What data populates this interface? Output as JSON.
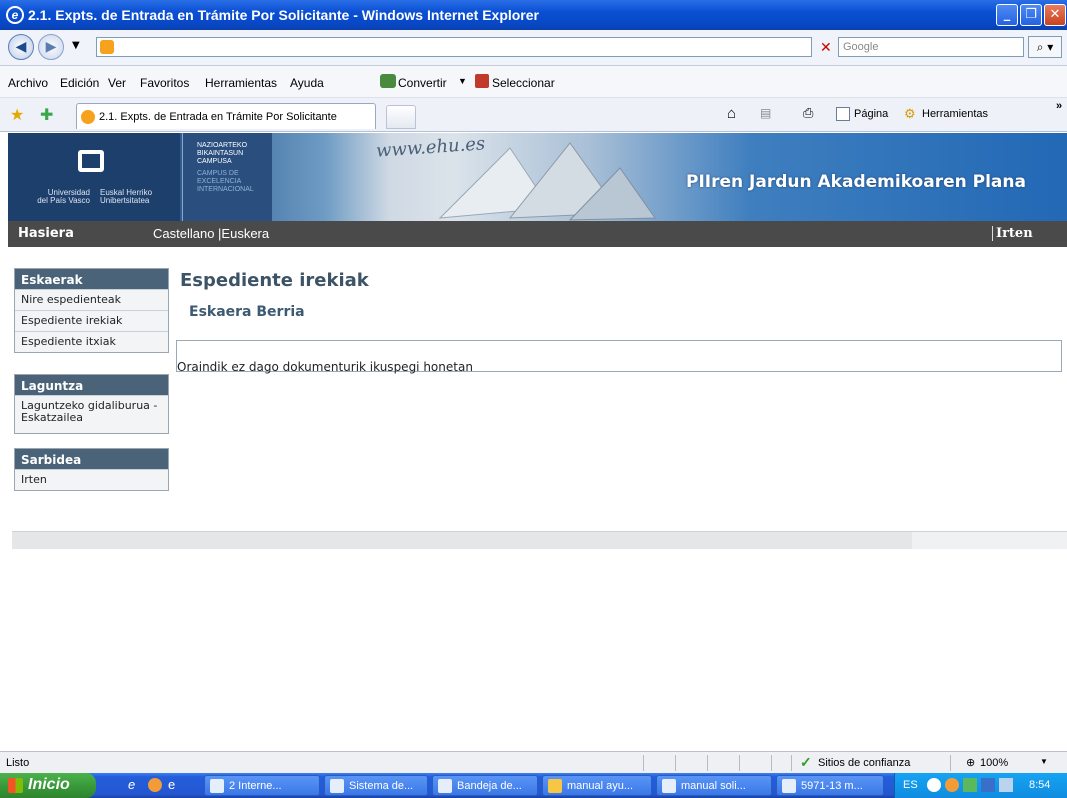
{
  "window": {
    "title": "2.1. Expts. de Entrada en Trámite Por Solicitante - Windows Internet Explorer",
    "minimize": "_",
    "maximize": "❐",
    "close": "✕"
  },
  "browser": {
    "address_value": "",
    "search_placeholder": "Google",
    "menu": [
      "Archivo",
      "Edición",
      "Ver",
      "Favoritos",
      "Herramientas",
      "Ayuda"
    ],
    "convert_label": "Convertir",
    "select_label": "Seleccionar",
    "tab_title": "2.1. Expts. de Entrada en Trámite Por Solicitante",
    "page_label": "Página",
    "tools_label": "Herramientas"
  },
  "banner": {
    "uni_left": [
      "Universidad",
      "del País Vasco"
    ],
    "uni_right": [
      "Euskal Herriko",
      "Unibertsitatea"
    ],
    "campus_lines_top": [
      "NAZIOARTEKO",
      "BIKAINTASUN",
      "CAMPUSA"
    ],
    "campus_lines_bottom": [
      "CAMPUS DE",
      "EXCELENCIA",
      "INTERNACIONAL"
    ],
    "www": "www.ehu.es",
    "title": "PIIren Jardun Akademikoaren Plana"
  },
  "nav": {
    "home": "Hasiera",
    "languages": "Castellano |Euskera",
    "logout": "Irten"
  },
  "sidebar": {
    "sections": [
      {
        "title": "Eskaerak",
        "items": [
          "Nire espedienteak",
          "Espediente irekiak",
          "Espediente itxiak"
        ]
      },
      {
        "title": "Laguntza",
        "items": [
          "Laguntzeko gidaliburua - Eskatzailea"
        ]
      },
      {
        "title": "Sarbidea",
        "items": [
          "Irten"
        ]
      }
    ]
  },
  "main": {
    "title": "Espediente irekiak",
    "new_request": "Eskaera Berria",
    "empty_message": "Oraindik ez dago dokumenturik ikuspegi honetan"
  },
  "status": {
    "text": "Listo",
    "zone": "Sitios de confianza",
    "zoom": "100%"
  },
  "taskbar": {
    "start": "Inicio",
    "buttons": [
      "2 Interne...",
      "Sistema de...",
      "Bandeja de...",
      "manual ayu...",
      "manual soli...",
      "5971-13 m..."
    ],
    "lang": "ES",
    "clock": "8:54"
  }
}
